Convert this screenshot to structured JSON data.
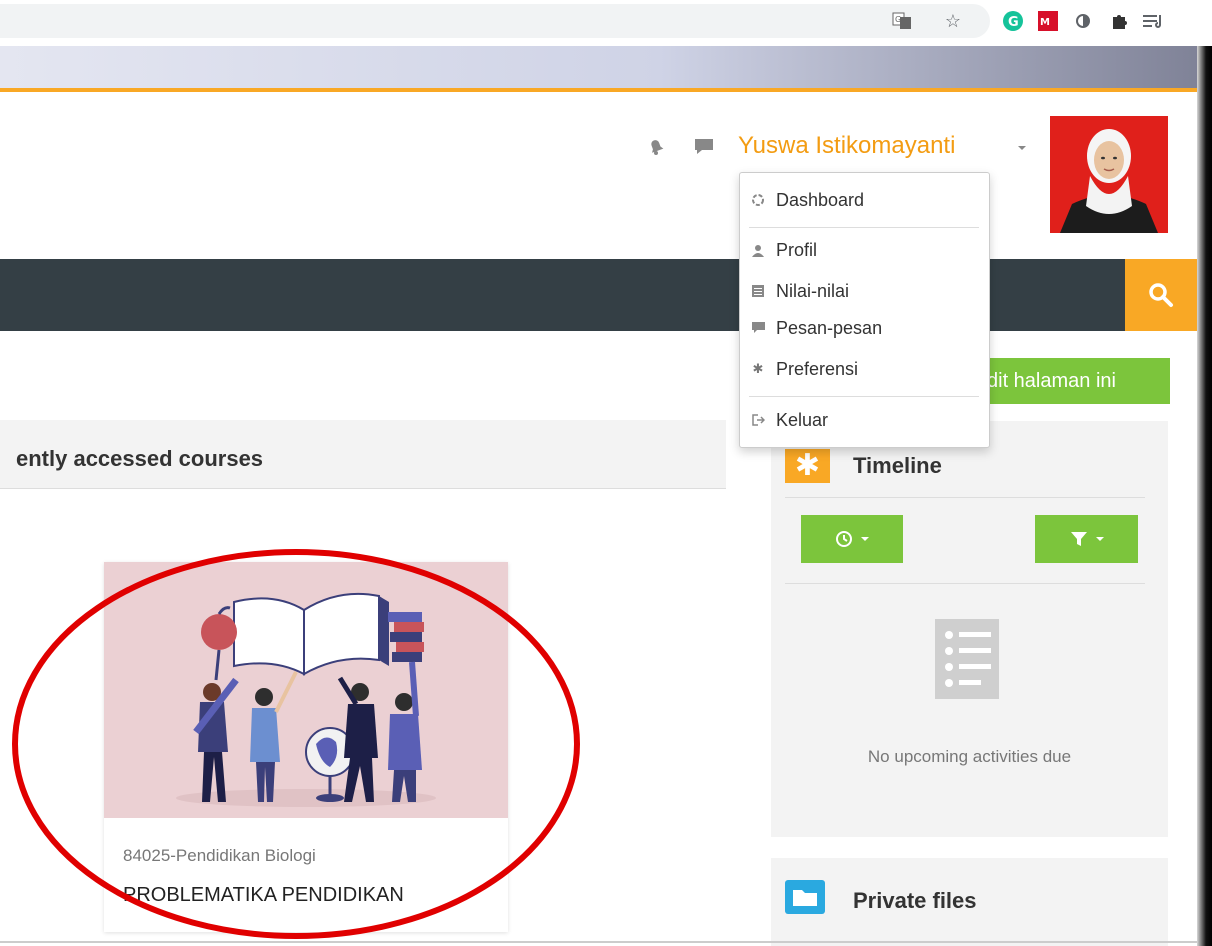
{
  "browser": {
    "icons": [
      "translate-icon",
      "star-icon",
      "grammarly-icon",
      "mendeley-icon",
      "circle-icon",
      "puzzle-icon",
      "reading-list-icon"
    ]
  },
  "header": {
    "user_name": "Yuswa Istikomayanti",
    "icons": [
      "bell-icon",
      "chat-icon"
    ]
  },
  "user_menu": {
    "items": [
      {
        "label": "Dashboard",
        "icon": "dashboard-icon"
      },
      {
        "label": "Profil",
        "icon": "user-icon"
      },
      {
        "label": "Nilai-nilai",
        "icon": "grades-icon"
      },
      {
        "label": "Pesan-pesan",
        "icon": "message-icon"
      },
      {
        "label": "Preferensi",
        "icon": "gear-icon"
      },
      {
        "label": "Keluar",
        "icon": "logout-icon"
      }
    ]
  },
  "page": {
    "edit_button": "dit halaman ini"
  },
  "recent": {
    "title": "ently accessed courses",
    "course": {
      "category": "84025-Pendidikan Biologi",
      "name": "PROBLEMATIKA PENDIDIKAN"
    }
  },
  "timeline": {
    "title": "Timeline",
    "empty_text": "No upcoming activities due"
  },
  "private_files": {
    "title": "Private files"
  },
  "colors": {
    "accent": "#f9a825",
    "green": "#7cc53c",
    "navbar": "#343f45",
    "annotation": "#e00000"
  }
}
